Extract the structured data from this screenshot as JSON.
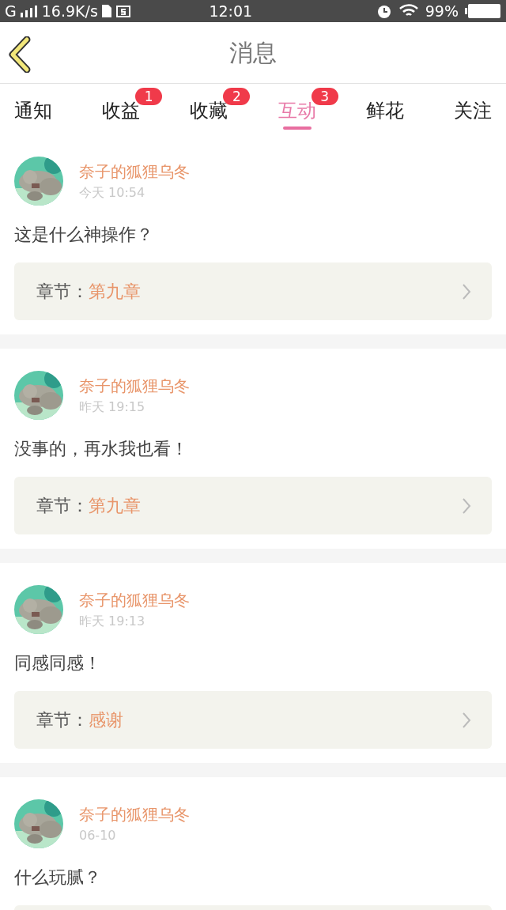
{
  "status_bar": {
    "network": "G",
    "speed": "16.9K/s",
    "time": "12:01",
    "battery": "99%"
  },
  "header": {
    "title": "消息"
  },
  "tabs": [
    {
      "label": "通知",
      "selected": false
    },
    {
      "label": "收益",
      "selected": false,
      "badge": "1"
    },
    {
      "label": "收藏",
      "selected": false,
      "badge": "2"
    },
    {
      "label": "互动",
      "selected": true,
      "badge": "3"
    },
    {
      "label": "鲜花",
      "selected": false
    },
    {
      "label": "关注",
      "selected": false
    }
  ],
  "messages": [
    {
      "user": "奈子的狐狸乌冬",
      "time": "今天 10:54",
      "text": "这是什么神操作？",
      "chapter_label": "章节：",
      "chapter": "第九章"
    },
    {
      "user": "奈子的狐狸乌冬",
      "time": "昨天 19:15",
      "text": "没事的，再水我也看！",
      "chapter_label": "章节：",
      "chapter": "第九章"
    },
    {
      "user": "奈子的狐狸乌冬",
      "time": "昨天 19:13",
      "text": "同感同感！",
      "chapter_label": "章节：",
      "chapter": "感谢"
    },
    {
      "user": "奈子的狐狸乌冬",
      "time": "06-10",
      "text": "什么玩腻？"
    }
  ]
}
